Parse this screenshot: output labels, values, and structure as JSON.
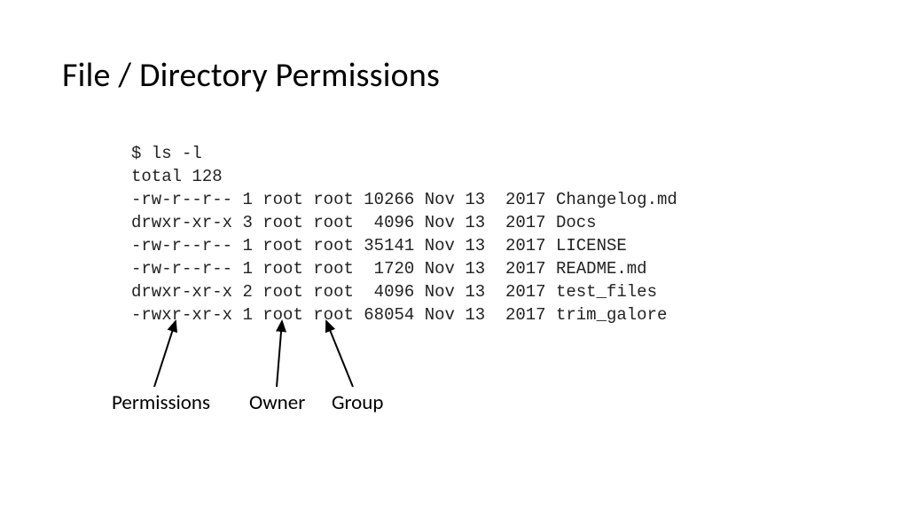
{
  "title": "File / Directory Permissions",
  "terminal": {
    "command": "$ ls -l",
    "total": "total 128",
    "rows": [
      {
        "perm": "-rw-r--r--",
        "links": "1",
        "owner": "root",
        "group": "root",
        "size": "10266",
        "month": "Nov",
        "day": "13",
        "year": "2017",
        "name": "Changelog.md"
      },
      {
        "perm": "drwxr-xr-x",
        "links": "3",
        "owner": "root",
        "group": "root",
        "size": " 4096",
        "month": "Nov",
        "day": "13",
        "year": "2017",
        "name": "Docs"
      },
      {
        "perm": "-rw-r--r--",
        "links": "1",
        "owner": "root",
        "group": "root",
        "size": "35141",
        "month": "Nov",
        "day": "13",
        "year": "2017",
        "name": "LICENSE"
      },
      {
        "perm": "-rw-r--r--",
        "links": "1",
        "owner": "root",
        "group": "root",
        "size": " 1720",
        "month": "Nov",
        "day": "13",
        "year": "2017",
        "name": "README.md"
      },
      {
        "perm": "drwxr-xr-x",
        "links": "2",
        "owner": "root",
        "group": "root",
        "size": " 4096",
        "month": "Nov",
        "day": "13",
        "year": "2017",
        "name": "test_files"
      },
      {
        "perm": "-rwxr-xr-x",
        "links": "1",
        "owner": "root",
        "group": "root",
        "size": "68054",
        "month": "Nov",
        "day": "13",
        "year": "2017",
        "name": "trim_galore"
      }
    ]
  },
  "labels": {
    "permissions": "Permissions",
    "owner": "Owner",
    "group": "Group"
  }
}
